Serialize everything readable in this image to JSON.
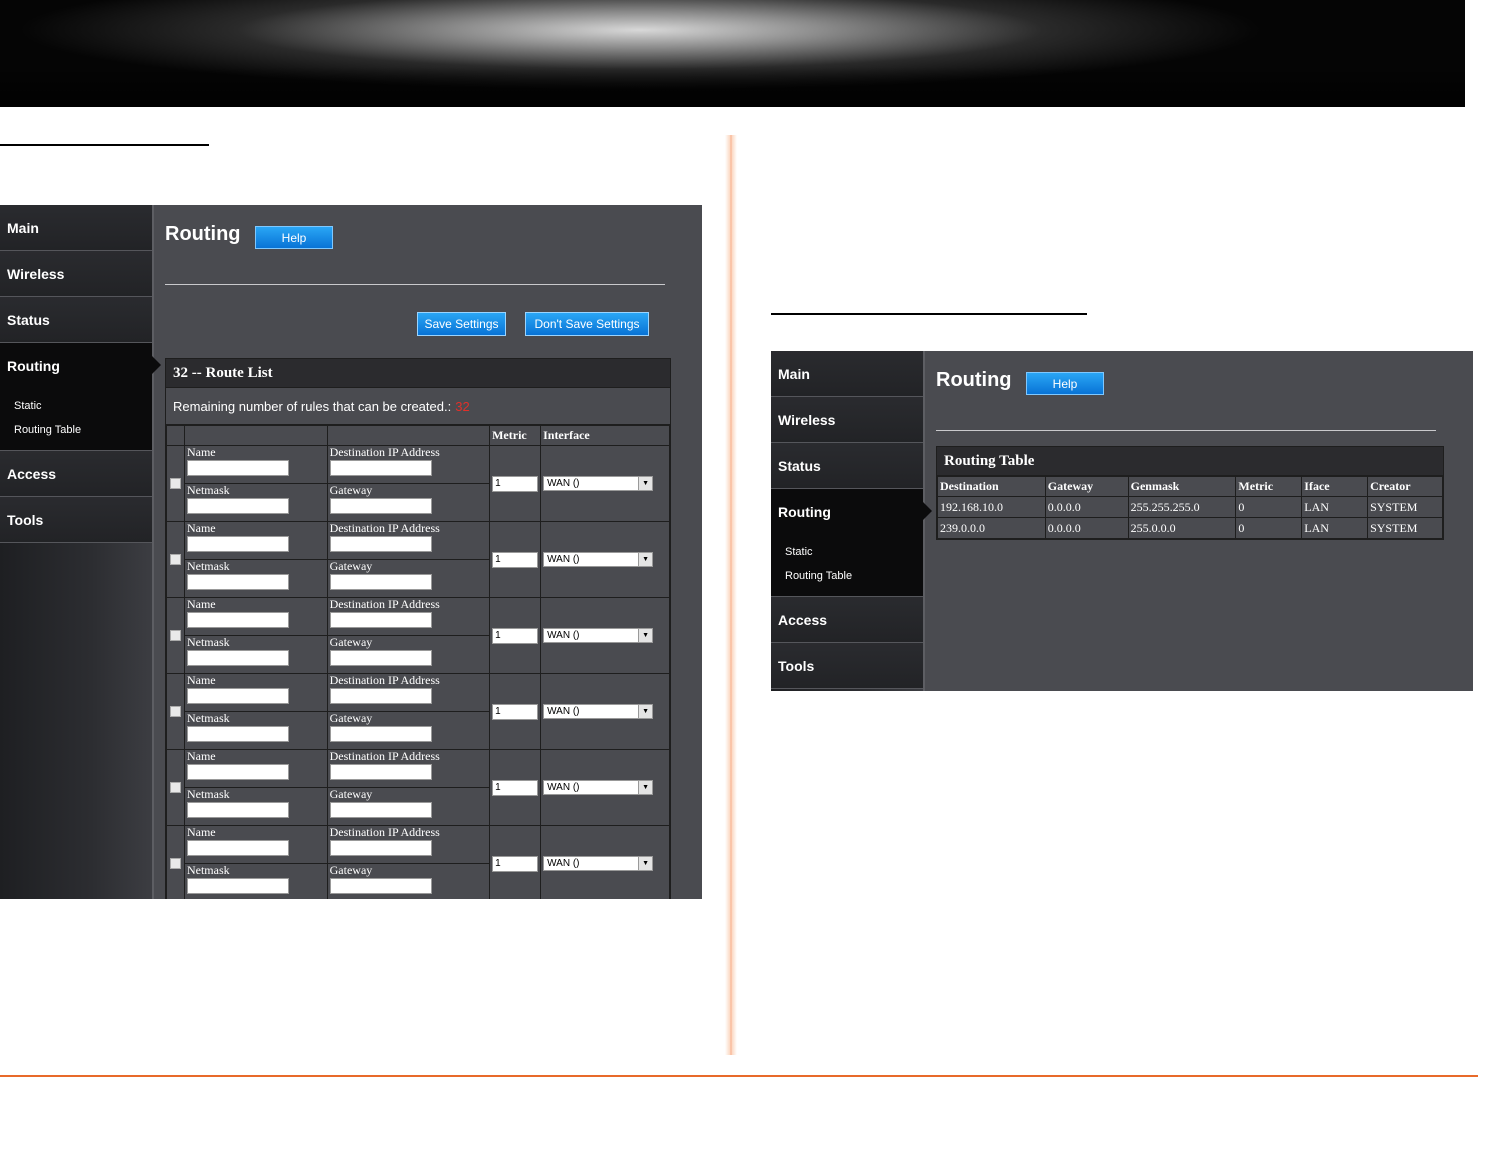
{
  "left_panel": {
    "sidebar": [
      {
        "label": "Main"
      },
      {
        "label": "Wireless"
      },
      {
        "label": "Status"
      },
      {
        "label": "Routing"
      },
      {
        "label": "Access"
      },
      {
        "label": "Tools"
      }
    ],
    "subnav": [
      {
        "label": "Static"
      },
      {
        "label": "Routing Table"
      }
    ],
    "page_title": "Routing",
    "help_label": "Help",
    "save_label": "Save Settings",
    "dont_save_label": "Don't Save Settings",
    "route_list_title": "32 -- Route List",
    "remaining_label": "Remaining number of rules that can be created.:",
    "remaining_value": "32",
    "headers": {
      "metric": "Metric",
      "interface": "Interface"
    },
    "field_labels": {
      "name": "Name",
      "dest": "Destination IP Address",
      "netmask": "Netmask",
      "gateway": "Gateway"
    },
    "rows": [
      {
        "metric": "1",
        "interface": "WAN ()"
      },
      {
        "metric": "1",
        "interface": "WAN ()"
      },
      {
        "metric": "1",
        "interface": "WAN ()"
      },
      {
        "metric": "1",
        "interface": "WAN ()"
      },
      {
        "metric": "1",
        "interface": "WAN ()"
      },
      {
        "metric": "1",
        "interface": "WAN ()"
      }
    ]
  },
  "right_panel": {
    "sidebar": [
      {
        "label": "Main"
      },
      {
        "label": "Wireless"
      },
      {
        "label": "Status"
      },
      {
        "label": "Routing"
      },
      {
        "label": "Access"
      },
      {
        "label": "Tools"
      }
    ],
    "subnav": [
      {
        "label": "Static"
      },
      {
        "label": "Routing Table"
      }
    ],
    "page_title": "Routing",
    "help_label": "Help",
    "table_title": "Routing Table",
    "columns": [
      "Destination",
      "Gateway",
      "Genmask",
      "Metric",
      "Iface",
      "Creator"
    ],
    "rows": [
      [
        "192.168.10.0",
        "0.0.0.0",
        "255.255.255.0",
        "0",
        "LAN",
        "SYSTEM"
      ],
      [
        "239.0.0.0",
        "0.0.0.0",
        "255.0.0.0",
        "0",
        "LAN",
        "SYSTEM"
      ]
    ]
  },
  "colors": {
    "accent_blue": "#0b8ae6",
    "divider_orange": "#e86a2a",
    "panel_bg": "#4a4b50"
  }
}
